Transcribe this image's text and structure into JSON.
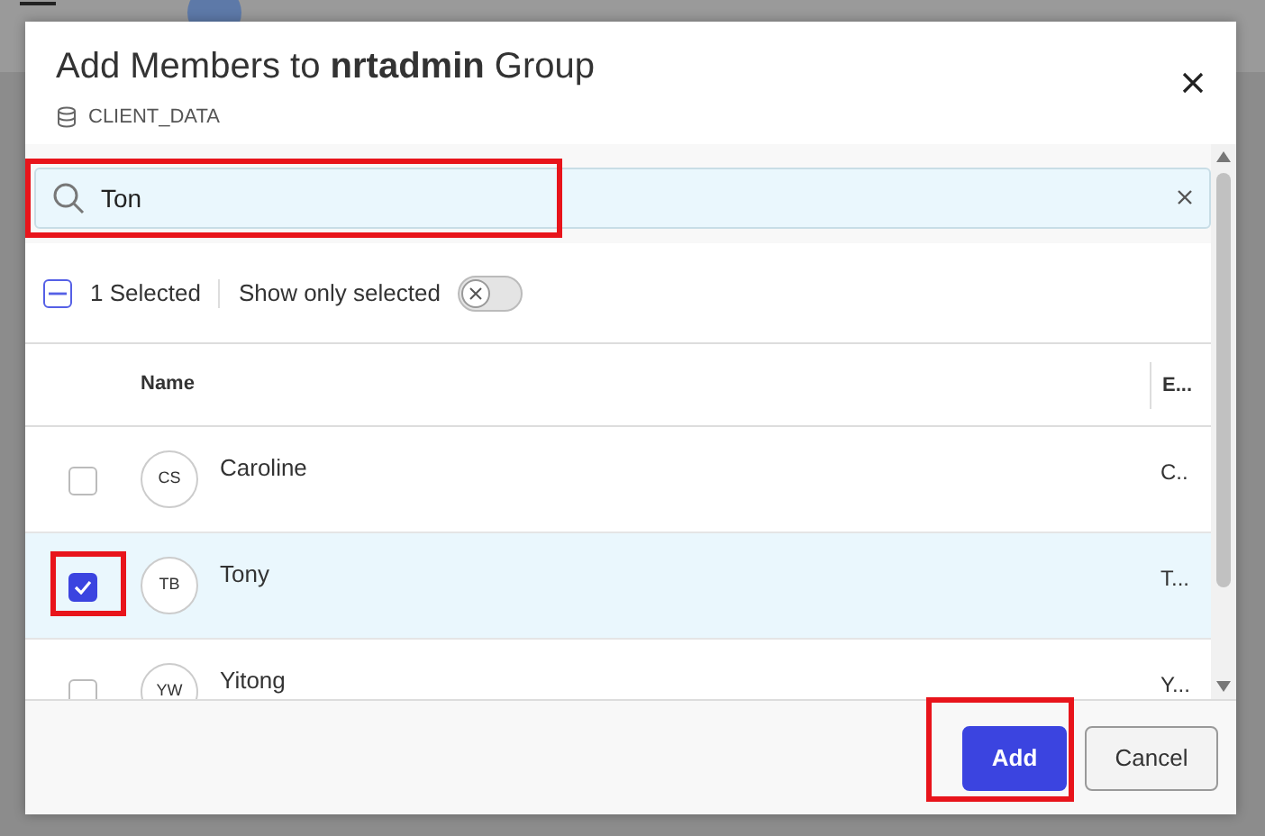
{
  "dialog": {
    "title": "Add Members to **nrtadmin** Group",
    "subtitle": "CLIENT_DATA",
    "search": {
      "value": "Ton",
      "highlighted": true
    },
    "toolbar": {
      "select_all_partial": true,
      "selected_count": "1 Selected",
      "show_only_selected_label": "Show only selected",
      "show_only_selected_on": false
    },
    "table": {
      "columns": [
        "Name",
        "E..."
      ],
      "rows": [
        {
          "initials": "CS",
          "name": "Caroline",
          "column_2": "C..",
          "selected": false,
          "checkbox_highlighted": false
        },
        {
          "initials": "TB",
          "name": "Tony",
          "column_2": "T...",
          "selected": true,
          "checkbox_highlighted": true
        },
        {
          "initials": "YW",
          "name": "Yitong",
          "column_2": "Y...",
          "selected": false,
          "checkbox_highlighted": false
        }
      ]
    },
    "buttons": [
      {
        "label": "Add",
        "kind": "primary",
        "highlighted": true
      },
      {
        "label": "Cancel",
        "kind": "secondary",
        "highlighted": false
      }
    ]
  }
}
